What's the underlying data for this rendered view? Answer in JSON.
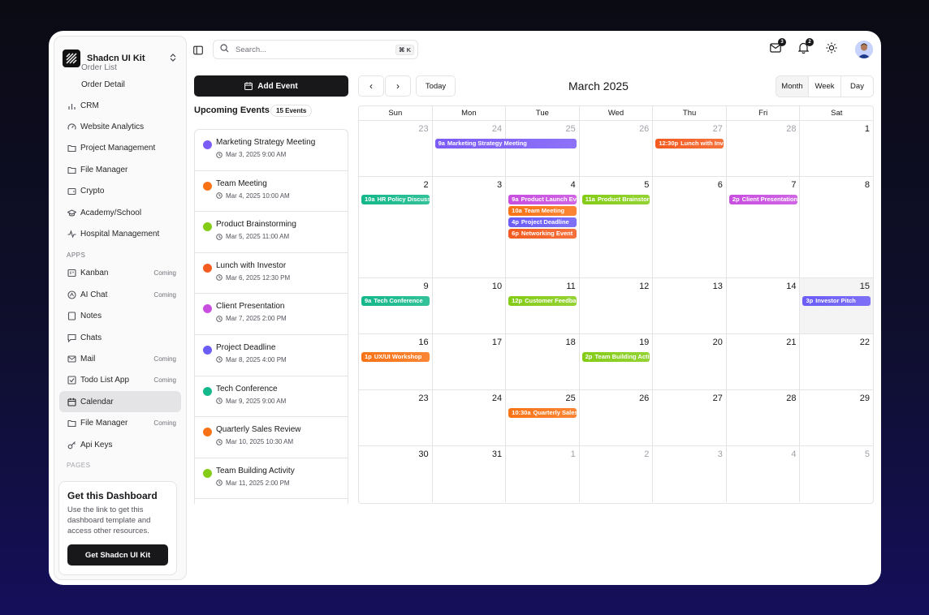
{
  "brand": {
    "name": "Shadcn UI Kit"
  },
  "sidebar": {
    "sub_items": [
      "Order List",
      "Order Detail"
    ],
    "items": [
      {
        "label": "CRM",
        "icon": "bar-chart-icon"
      },
      {
        "label": "Website Analytics",
        "icon": "gauge-icon"
      },
      {
        "label": "Project Management",
        "icon": "folder-icon"
      },
      {
        "label": "File Manager",
        "icon": "folder-icon"
      },
      {
        "label": "Crypto",
        "icon": "wallet-icon"
      },
      {
        "label": "Academy/School",
        "icon": "graduation-cap-icon"
      },
      {
        "label": "Hospital Management",
        "icon": "activity-icon"
      }
    ],
    "apps_section": "APPS",
    "apps": [
      {
        "label": "Kanban",
        "tag": "Coming",
        "icon": "kanban-icon"
      },
      {
        "label": "AI Chat",
        "tag": "Coming",
        "icon": "bot-icon"
      },
      {
        "label": "Notes",
        "tag": "",
        "icon": "note-icon"
      },
      {
        "label": "Chats",
        "tag": "",
        "icon": "chat-icon"
      },
      {
        "label": "Mail",
        "tag": "Coming",
        "icon": "mail-icon"
      },
      {
        "label": "Todo List App",
        "tag": "Coming",
        "icon": "checkbox-icon"
      },
      {
        "label": "Calendar",
        "tag": "",
        "icon": "calendar-icon",
        "active": true
      },
      {
        "label": "File Manager",
        "tag": "Coming",
        "icon": "folder-icon"
      },
      {
        "label": "Api Keys",
        "tag": "",
        "icon": "key-icon"
      }
    ],
    "pages_section": "PAGES",
    "promo": {
      "title": "Get this Dashboard",
      "text": "Use the link to get this dashboard template and access other resources.",
      "button": "Get Shadcn UI Kit"
    }
  },
  "header": {
    "search_placeholder": "Search...",
    "shortcut": "⌘ K",
    "mail_badge": "3",
    "bell_badge": "2"
  },
  "events_panel": {
    "add_button": "Add Event",
    "title": "Upcoming Events",
    "count": "15 Events",
    "events": [
      {
        "title": "Marketing Strategy Meeting",
        "date": "Mar 3, 2025 9:00 AM",
        "color": "#7c5cf6"
      },
      {
        "title": "Team Meeting",
        "date": "Mar 4, 2025 10:00 AM",
        "color": "#f97316"
      },
      {
        "title": "Product Brainstorming",
        "date": "Mar 5, 2025 11:00 AM",
        "color": "#84cc16"
      },
      {
        "title": "Lunch with Investor",
        "date": "Mar 6, 2025 12:30 PM",
        "color": "#f45b1f"
      },
      {
        "title": "Client Presentation",
        "date": "Mar 7, 2025 2:00 PM",
        "color": "#c84ee0"
      },
      {
        "title": "Project Deadline",
        "date": "Mar 8, 2025 4:00 PM",
        "color": "#6b5cf6"
      },
      {
        "title": "Tech Conference",
        "date": "Mar 9, 2025 9:00 AM",
        "color": "#14b88a"
      },
      {
        "title": "Quarterly Sales Review",
        "date": "Mar 10, 2025 10:30 AM",
        "color": "#f97316"
      },
      {
        "title": "Team Building Activity",
        "date": "Mar 11, 2025 2:00 PM",
        "color": "#84cc16"
      }
    ]
  },
  "calendar": {
    "month_title": "March 2025",
    "today_label": "Today",
    "prev_icon": "‹",
    "next_icon": "›",
    "views": [
      "Month",
      "Week",
      "Day"
    ],
    "active_view": "Month",
    "weekdays": [
      "Sun",
      "Mon",
      "Tue",
      "Wed",
      "Thu",
      "Fri",
      "Sat"
    ],
    "weeks": [
      [
        "23",
        "24",
        "25",
        "26",
        "27",
        "28",
        "1"
      ],
      [
        "2",
        "3",
        "4",
        "5",
        "6",
        "7",
        "8"
      ],
      [
        "9",
        "10",
        "11",
        "12",
        "13",
        "14",
        "15"
      ],
      [
        "16",
        "17",
        "18",
        "19",
        "20",
        "21",
        "22"
      ],
      [
        "23",
        "24",
        "25",
        "26",
        "27",
        "28",
        "29"
      ],
      [
        "30",
        "31",
        "1",
        "2",
        "3",
        "4",
        "5"
      ]
    ],
    "muted_cells": [
      [
        0,
        0
      ],
      [
        0,
        1
      ],
      [
        0,
        2
      ],
      [
        0,
        3
      ],
      [
        0,
        4
      ],
      [
        0,
        5
      ],
      [
        5,
        2
      ],
      [
        5,
        3
      ],
      [
        5,
        4
      ],
      [
        5,
        5
      ],
      [
        5,
        6
      ]
    ],
    "highlight_cell": [
      2,
      6
    ],
    "events": [
      {
        "week": 0,
        "day": 1,
        "span": 2,
        "slot": 0,
        "time": "9a",
        "title": "Marketing Strategy Meeting",
        "color": "#7c5cf6"
      },
      {
        "week": 0,
        "day": 4,
        "span": 1,
        "slot": 0,
        "time": "12:30p",
        "title": "Lunch with Investor",
        "color": "#f45b1f"
      },
      {
        "week": 1,
        "day": 0,
        "span": 1,
        "slot": 0,
        "time": "10a",
        "title": "HR Policy Discussion",
        "color": "#14b88a"
      },
      {
        "week": 1,
        "day": 2,
        "span": 1,
        "slot": 0,
        "time": "9a",
        "title": "Product Launch Event",
        "color": "#c84ee0"
      },
      {
        "week": 1,
        "day": 2,
        "span": 1,
        "slot": 1,
        "time": "10a",
        "title": "Team Meeting",
        "color": "#f97316"
      },
      {
        "week": 1,
        "day": 2,
        "span": 1,
        "slot": 2,
        "time": "4p",
        "title": "Project Deadline",
        "color": "#6b5cf6"
      },
      {
        "week": 1,
        "day": 2,
        "span": 1,
        "slot": 3,
        "time": "6p",
        "title": "Networking Event",
        "color": "#f45b1f"
      },
      {
        "week": 1,
        "day": 3,
        "span": 1,
        "slot": 0,
        "time": "11a",
        "title": "Product Brainstorming",
        "color": "#84cc16"
      },
      {
        "week": 1,
        "day": 5,
        "span": 1,
        "slot": 0,
        "time": "2p",
        "title": "Client Presentation",
        "color": "#c84ee0"
      },
      {
        "week": 2,
        "day": 0,
        "span": 1,
        "slot": 0,
        "time": "9a",
        "title": "Tech Conference",
        "color": "#14b88a"
      },
      {
        "week": 2,
        "day": 2,
        "span": 1,
        "slot": 0,
        "time": "12p",
        "title": "Customer Feedback",
        "color": "#84cc16"
      },
      {
        "week": 2,
        "day": 6,
        "span": 1,
        "slot": 0,
        "time": "3p",
        "title": "Investor Pitch",
        "color": "#6b5cf6"
      },
      {
        "week": 3,
        "day": 0,
        "span": 1,
        "slot": 0,
        "time": "1p",
        "title": "UX/UI Workshop",
        "color": "#f97316"
      },
      {
        "week": 3,
        "day": 3,
        "span": 1,
        "slot": 0,
        "time": "2p",
        "title": "Team Building Activity",
        "color": "#84cc16"
      },
      {
        "week": 4,
        "day": 2,
        "span": 1,
        "slot": 0,
        "time": "10:30a",
        "title": "Quarterly Sales Review",
        "color": "#f97316"
      }
    ]
  }
}
